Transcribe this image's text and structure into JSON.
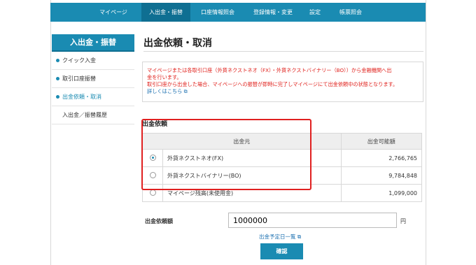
{
  "nav": {
    "items": [
      "マイページ",
      "入出金・振替",
      "口座情報照会",
      "登録情報・変更",
      "設定",
      "帳票照会"
    ],
    "active": "入出金・振替"
  },
  "sidebar": {
    "header": "入出金・振替",
    "items": [
      "クイック入金",
      "取引口座振替",
      "出金依頼・取消",
      "入出金／振替履歴"
    ]
  },
  "page": {
    "title": "出金依頼・取消",
    "notice_line1": "マイページまたは各取引口座（外貨ネクストネオ（FX）・外貨ネクストバイナリー（BO））から金融機関へ出",
    "notice_line2": "金を行います。",
    "notice_line3": "取引口座から出金した場合、マイページへの振替が即時に完了しマイページにて出金依頼中の状態となります。",
    "notice_link": "詳しくはこちら"
  },
  "withdrawal": {
    "section_label": "出金依頼",
    "col_source": "出金元",
    "col_available": "出金可能額",
    "rows": [
      {
        "name": "外貨ネクストネオ(FX)",
        "amount": "2,766,765"
      },
      {
        "name": "外貨ネクストバイナリー(BO)",
        "amount": "9,784,848"
      },
      {
        "name": "マイページ残高(未使用金)",
        "amount": "1,099,000"
      }
    ],
    "selected_row": 0,
    "amount_label": "出金依頼額",
    "amount_value": "1000000",
    "unit": "円",
    "schedule_link": "出金予定日一覧",
    "confirm_label": "確認"
  }
}
